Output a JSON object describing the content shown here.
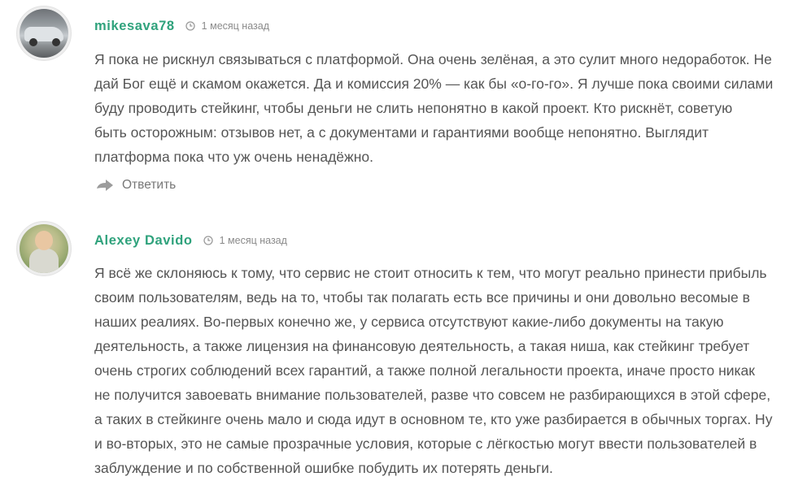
{
  "comments": [
    {
      "author": "mikesava78",
      "time": "1 месяц назад",
      "lines": [
        "Я пока не рискнул связываться с платформой. Она очень зелёная, а это сулит много недоработок. Не",
        "дай Бог ещё и скамом окажется. Да и комиссия 20% — как бы «о-го-го». Я лучше пока своими силами",
        "буду проводить стейкинг, чтобы деньги не слить непонятно в какой проект. Кто рискнёт, советую",
        "быть осторожным: отзывов нет, а с документами и гарантиями вообще непонятно. Выглядит",
        "платформа пока что уж очень ненадёжно."
      ],
      "reply_label": "Ответить",
      "avatar_icon": "car-avatar"
    },
    {
      "author": "Alexey Davido",
      "time": "1 месяц назад",
      "lines": [
        "Я всё же склоняюсь к тому, что сервис не стоит относить к тем, что могут реально принести прибыль",
        "своим пользователям, ведь на то, чтобы так полагать есть все причины и они довольно весомые в",
        "наших реалиях. Во-первых конечно же, у сервиса отсутствуют какие-либо документы на такую",
        "деятельность, а также лицензия на финансовую деятельность, а такая ниша, как стейкинг требует",
        "очень строгих соблюдений всех гарантий, а также полной легальности проекта, иначе просто никак",
        "не получится завоевать внимание пользователей, разве что совсем не разбирающихся в этой сфере,",
        "а таких в стейкинге очень мало и сюда идут в основном те, кто уже разбирается в обычных торгах. Ну",
        "и во-вторых, это не самые прозрачные условия, которые с лёгкостью могут ввести пользователей в",
        "заблуждение и по собственной ошибке побудить их потерять деньги."
      ],
      "avatar_icon": "person-avatar"
    }
  ],
  "colors": {
    "author": "#2fa27c",
    "meta": "#8a8a8a",
    "text": "#555555"
  }
}
